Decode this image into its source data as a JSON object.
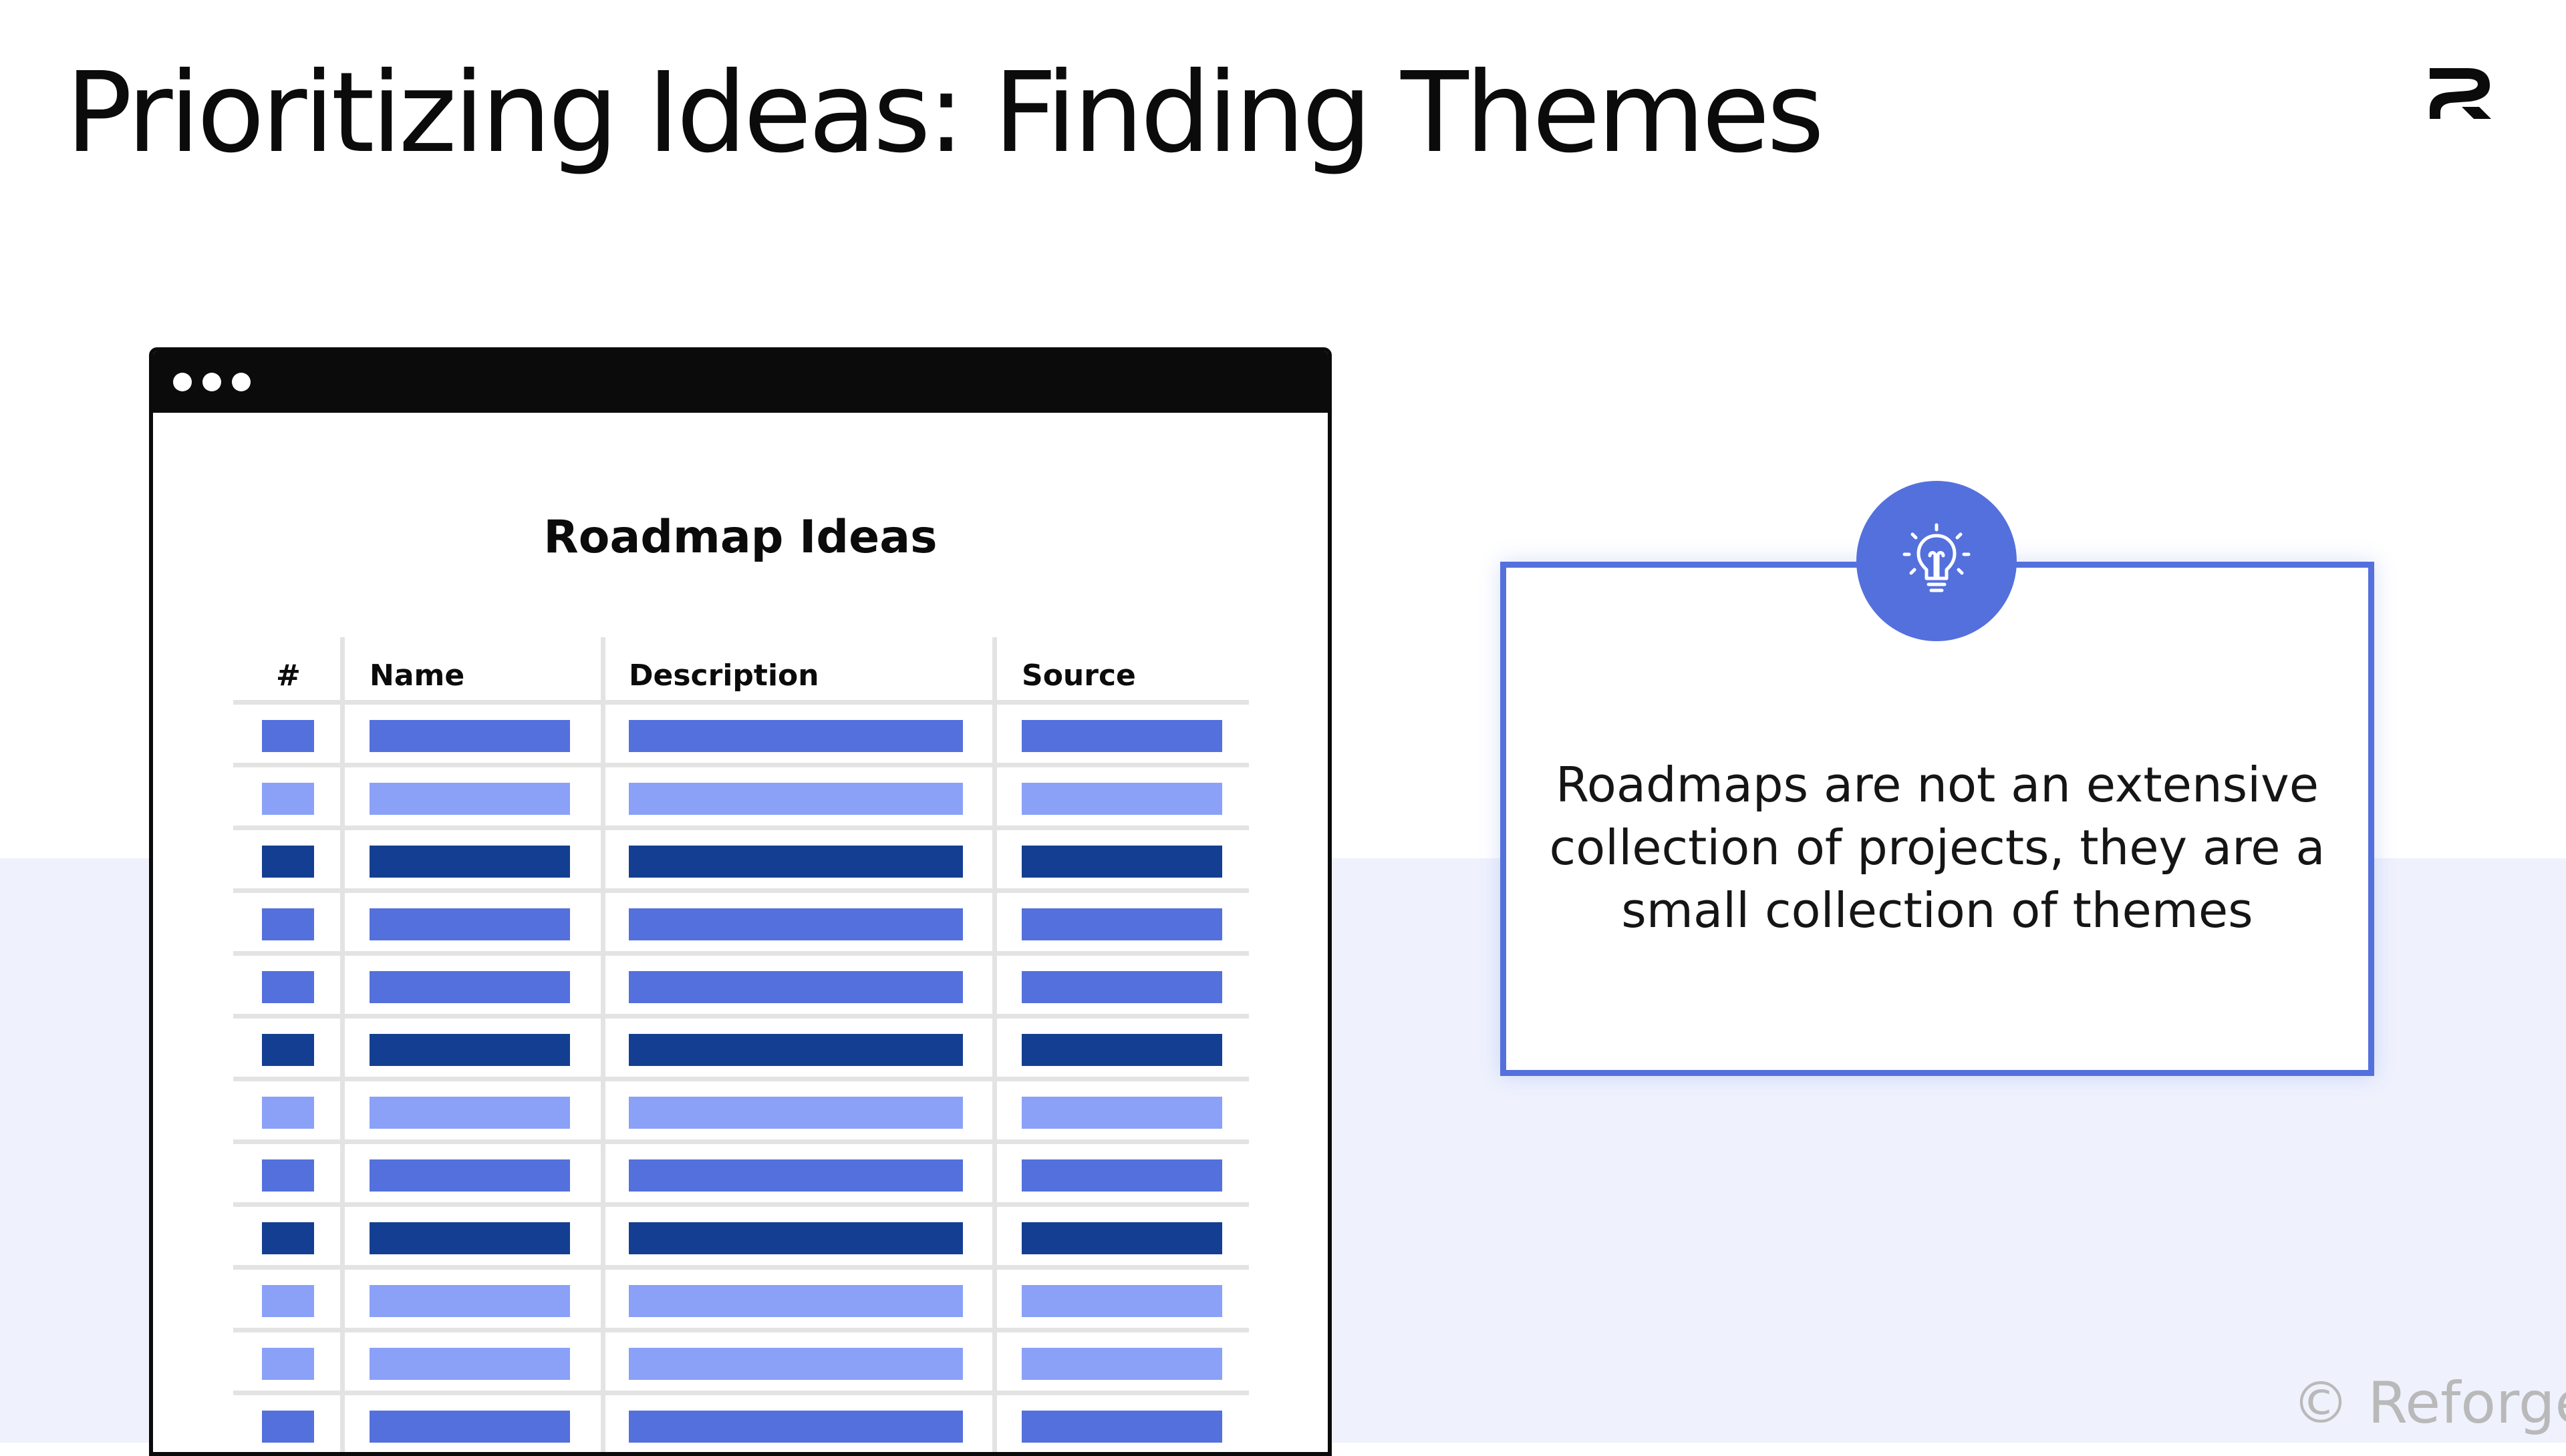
{
  "slide": {
    "title": "Prioritizing Ideas: Finding Themes"
  },
  "table": {
    "title": "Roadmap Ideas",
    "headers": [
      "#",
      "Name",
      "Description",
      "Source"
    ]
  },
  "callout": {
    "text": "Roadmaps are not an extensive collection of projects, they are a small collection of themes",
    "icon": "lightbulb-icon"
  },
  "footer": {
    "copyright": "© Reforge"
  },
  "icons": {
    "brand": "reforge-logo-icon",
    "window_dots": "window-dots-icon"
  },
  "colors": {
    "accent": "#5470dd",
    "bar_medium": "#5470dd",
    "bar_light": "#8aa1f7",
    "bar_dark": "#143e92",
    "background_band": "#eff2fd",
    "text": "#0b0b0b"
  },
  "row_shades": [
    "medium",
    "light",
    "dark",
    "medium",
    "medium",
    "dark",
    "light",
    "medium",
    "dark",
    "light",
    "light",
    "medium"
  ]
}
